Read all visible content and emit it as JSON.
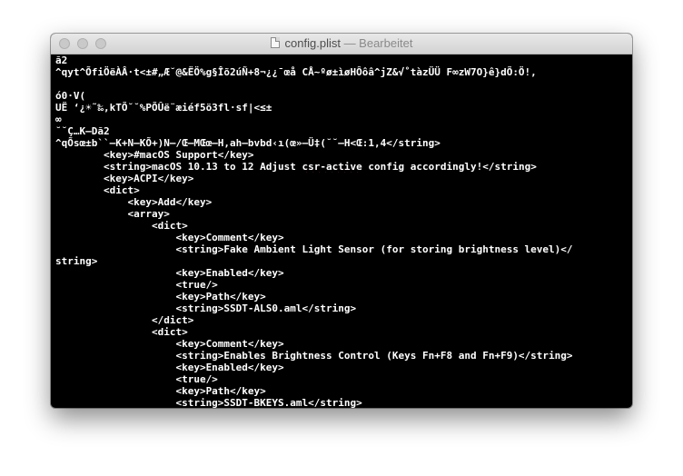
{
  "window": {
    "filename": "config.plist",
    "status": " — Bearbeitet"
  },
  "lines": [
    "ã2",
    "^qyt^ÕfiÖëÀÂ·t<±#„Æ˘@&ËÖ%g§Îõ2úÑ+8¬¿¿¯œå CÅ~ºø±ìøHÔôâ^jZ&√˚tàzÜÜ F∞zW7O}ê}dÕ:Ö!,",
    "",
    "ó0·V(",
    "UË ‘¿☀˜‰,kTÕ˘˘%PÕÛë¨æiéf5ö3fl·sf|<≤±",
    "∞",
    "˘˘Ç…K—Dã2",
    "^qÕsœ±b``—K+N—KÕ+)N—/Œ—MŒœ—H,ah—bvbd‹ı(œ»—Ü‡(˘˘—H<Œ:1,4</string>",
    "        <key>#macOS Support</key>",
    "        <string>macOS 10.13 to 12 Adjust csr-active config accordingly!</string>",
    "        <key>ACPI</key>",
    "        <dict>",
    "            <key>Add</key>",
    "            <array>",
    "                <dict>",
    "                    <key>Comment</key>",
    "                    <string>Fake Ambient Light Sensor (for storing brightness level)</",
    "string>",
    "                    <key>Enabled</key>",
    "                    <true/>",
    "                    <key>Path</key>",
    "                    <string>SSDT-ALS0.aml</string>",
    "                </dict>",
    "                <dict>",
    "                    <key>Comment</key>",
    "                    <string>Enables Brightness Control (Keys Fn+F8 and Fn+F9)</string>",
    "                    <key>Enabled</key>",
    "                    <true/>",
    "                    <key>Path</key>",
    "                    <string>SSDT-BKEYS.aml</string>"
  ]
}
